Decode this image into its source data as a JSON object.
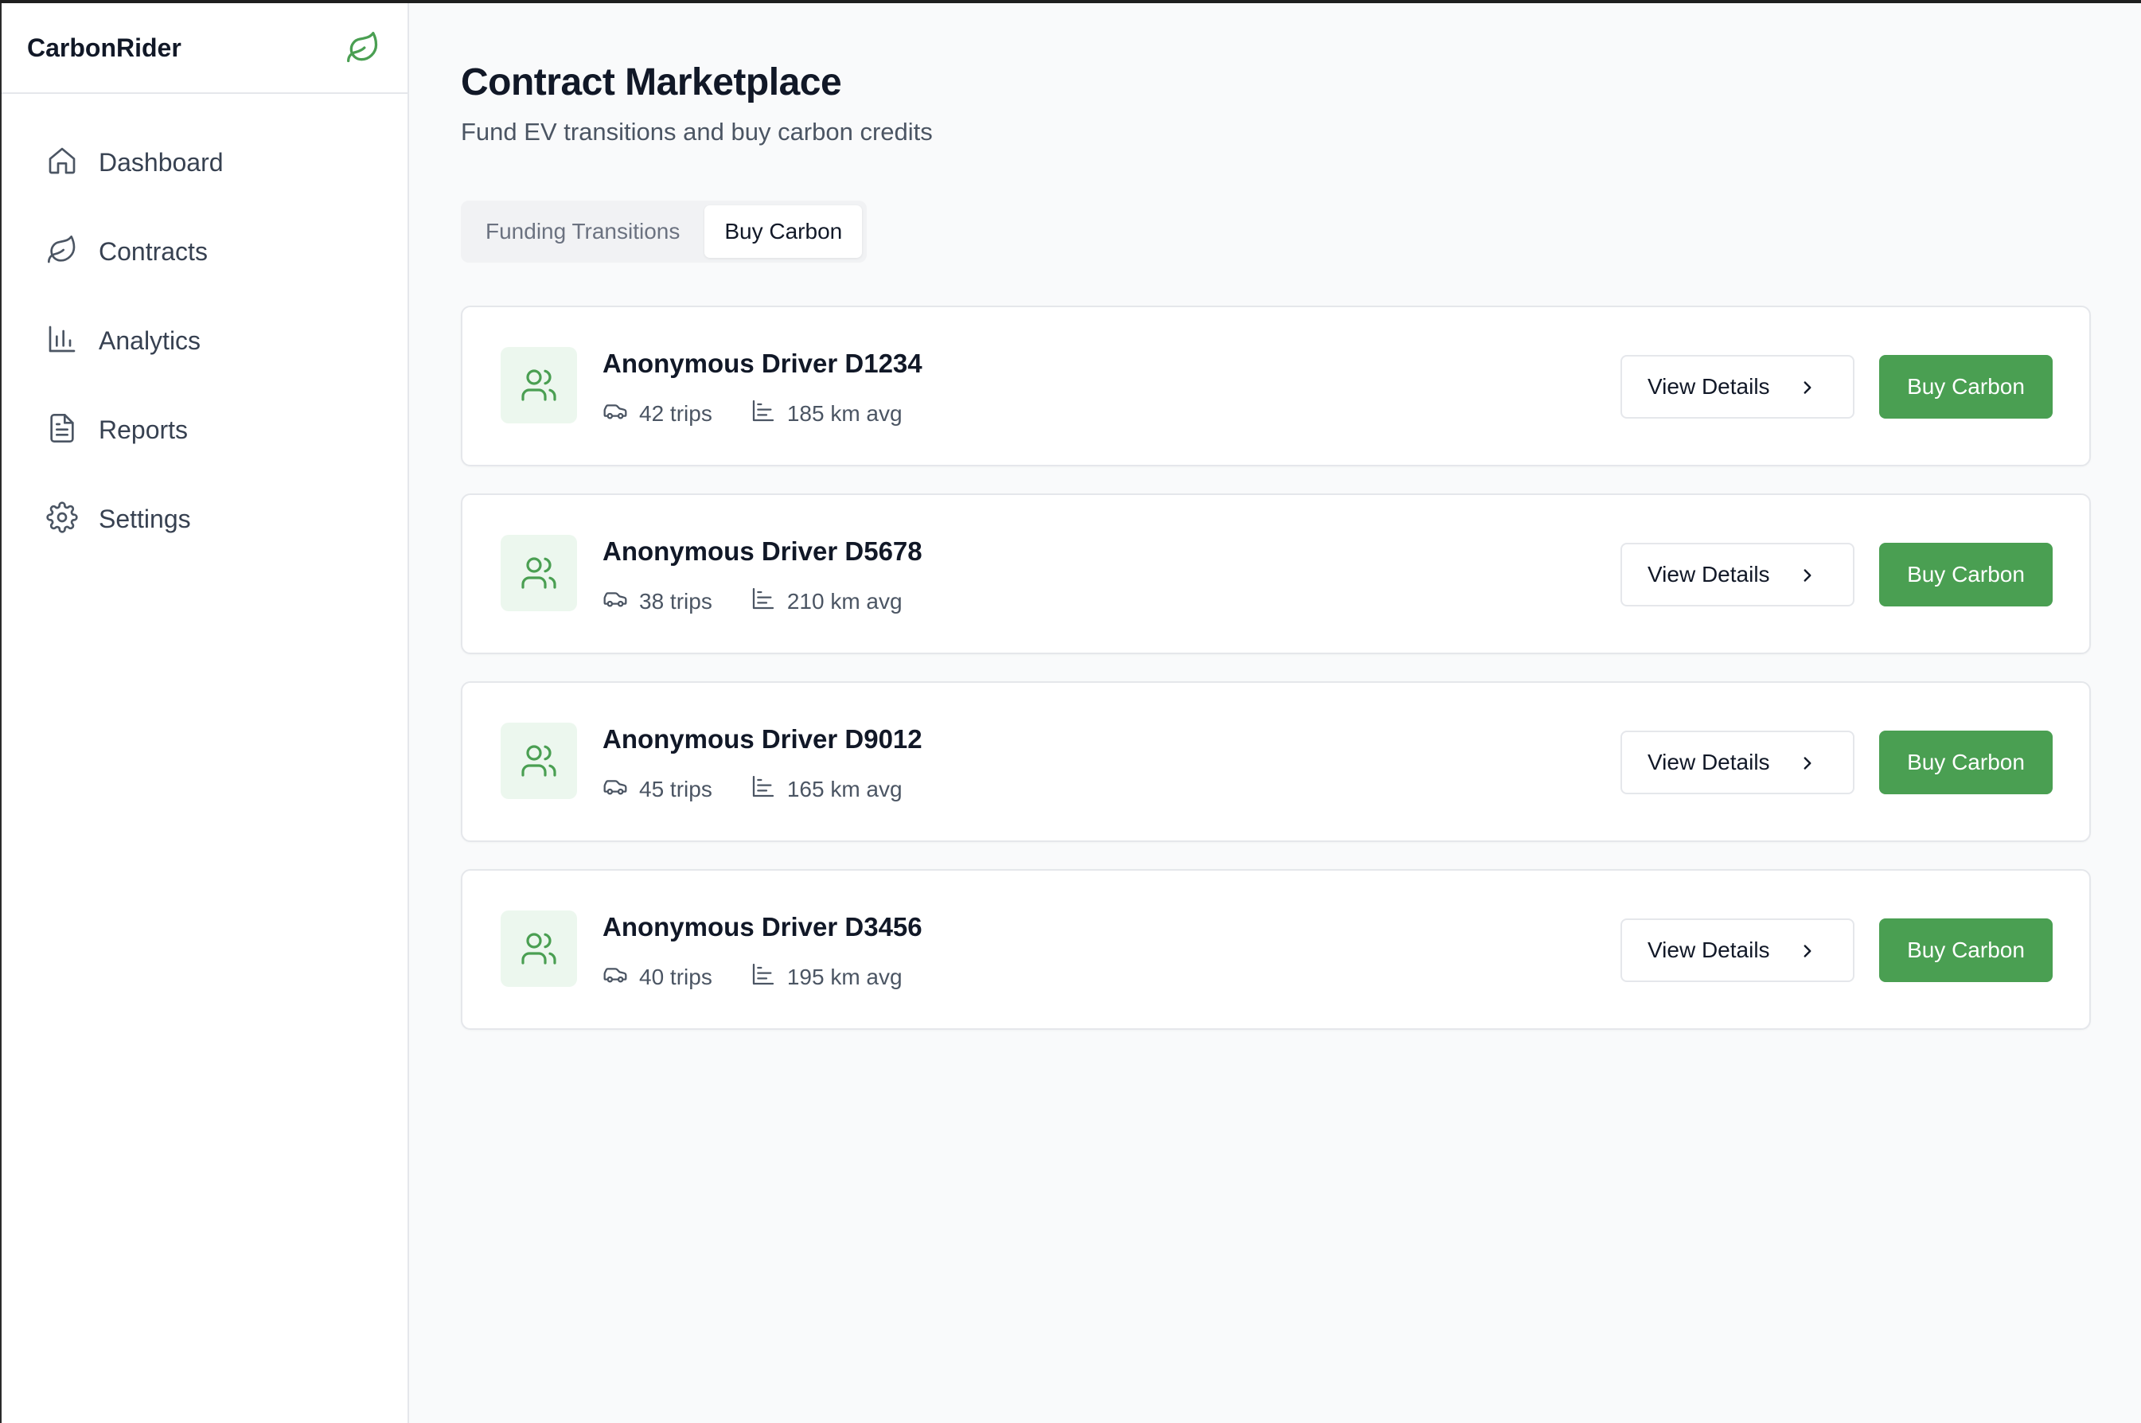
{
  "app": {
    "name": "CarbonRider",
    "brand_icon": "leaf-icon",
    "accent_color": "#4a9f52"
  },
  "sidebar": {
    "items": [
      {
        "label": "Dashboard",
        "icon": "home-icon"
      },
      {
        "label": "Contracts",
        "icon": "leaf-icon"
      },
      {
        "label": "Analytics",
        "icon": "bar-chart-icon"
      },
      {
        "label": "Reports",
        "icon": "document-icon"
      },
      {
        "label": "Settings",
        "icon": "gear-icon"
      }
    ]
  },
  "header": {
    "title": "Contract Marketplace",
    "subtitle": "Fund EV transitions and buy carbon credits"
  },
  "tabs": [
    {
      "label": "Funding Transitions",
      "active": false
    },
    {
      "label": "Buy Carbon",
      "active": true
    }
  ],
  "drivers": [
    {
      "name": "Anonymous Driver D1234",
      "trips": "42 trips",
      "avg": "185 km avg",
      "view_label": "View Details",
      "buy_label": "Buy Carbon"
    },
    {
      "name": "Anonymous Driver D5678",
      "trips": "38 trips",
      "avg": "210 km avg",
      "view_label": "View Details",
      "buy_label": "Buy Carbon"
    },
    {
      "name": "Anonymous Driver D9012",
      "trips": "45 trips",
      "avg": "165 km avg",
      "view_label": "View Details",
      "buy_label": "Buy Carbon"
    },
    {
      "name": "Anonymous Driver D3456",
      "trips": "40 trips",
      "avg": "195 km avg",
      "view_label": "View Details",
      "buy_label": "Buy Carbon"
    }
  ]
}
